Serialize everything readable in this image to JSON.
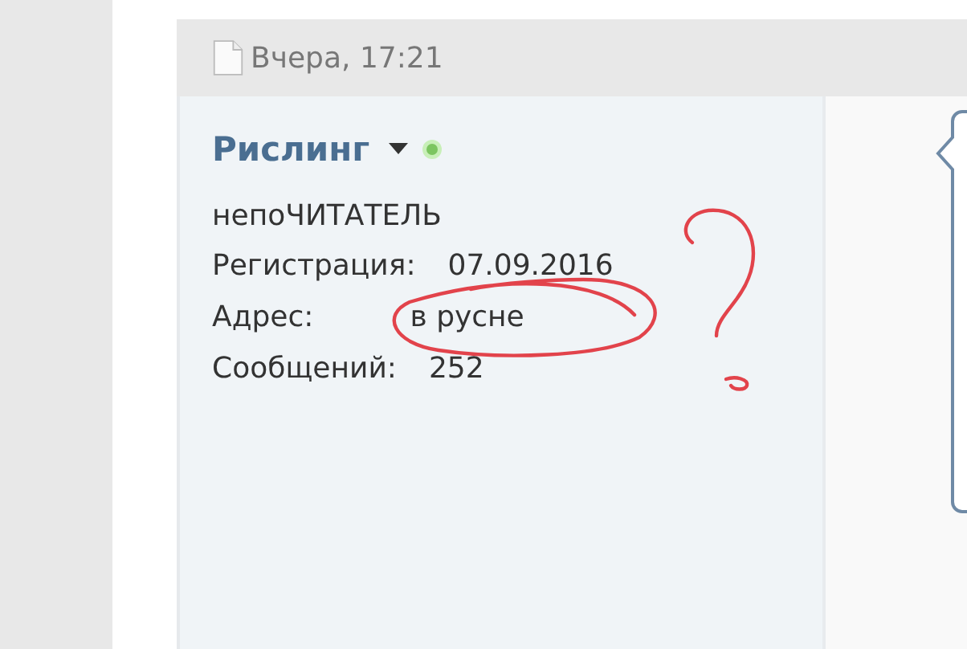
{
  "post": {
    "date": "Вчера, 17:21",
    "author": {
      "name": "Рислинг",
      "online": true,
      "title": "непоЧИТАТЕЛЬ",
      "fields": [
        {
          "label": "Регистрация:",
          "value": "07.09.2016"
        },
        {
          "label": "Адрес:",
          "value": "в русне"
        },
        {
          "label": "Сообщений:",
          "value": "252"
        }
      ]
    }
  }
}
